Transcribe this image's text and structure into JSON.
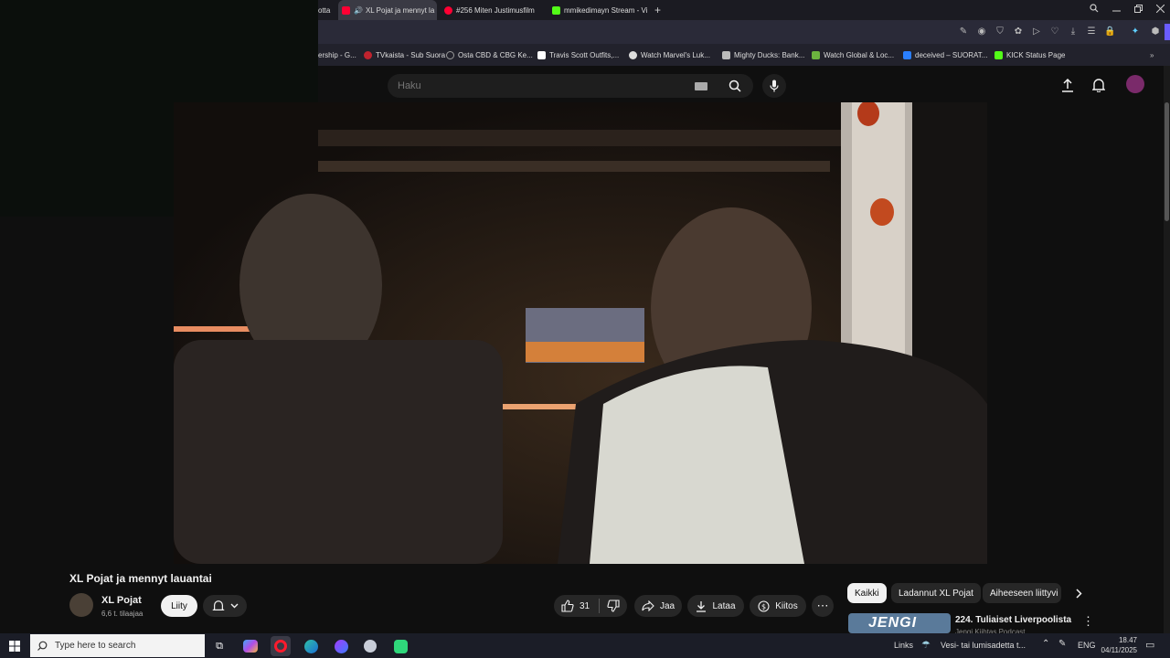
{
  "tabs": [
    {
      "label": "otta",
      "active": false
    },
    {
      "label": "XL Pojat ja mennyt la",
      "active": true
    },
    {
      "label": "#256 Miten Justimusfilm",
      "active": false
    },
    {
      "label": "mmikedimayn Stream - Vi",
      "active": false
    }
  ],
  "new_tab_label": "+",
  "bookmarks": [
    {
      "label": "ership - G...",
      "icon": "none"
    },
    {
      "label": "TVkaista - Sub Suora",
      "icon": "tvkaista-icon"
    },
    {
      "label": "Osta CBD & CBG Ke...",
      "icon": "cbd-icon"
    },
    {
      "label": "Travis Scott Outfits,...",
      "icon": "travis-icon"
    },
    {
      "label": "Watch Marvel's Luk...",
      "icon": "marvel-icon"
    },
    {
      "label": "Mighty Ducks: Bank...",
      "icon": "ducks-icon"
    },
    {
      "label": "Watch Global & Loc...",
      "icon": "global-icon"
    },
    {
      "label": "deceived – SUORAT...",
      "icon": "deceived-icon"
    },
    {
      "label": "KICK Status Page",
      "icon": "kick-icon"
    }
  ],
  "search": {
    "placeholder": "Haku"
  },
  "video": {
    "title": "XL Pojat ja mennyt lauantai"
  },
  "channel": {
    "name": "XL Pojat",
    "subscribers": "6,6 t. tilaajaa",
    "join_label": "Liity"
  },
  "actions": {
    "likes": "31",
    "share_label": "Jaa",
    "download_label": "Lataa",
    "thanks_label": "Kiitos"
  },
  "chips": [
    {
      "label": "Kaikki",
      "active": true
    },
    {
      "label": "Ladannut XL Pojat",
      "active": false
    },
    {
      "label": "Aiheeseen liittyvi",
      "active": false
    }
  ],
  "recommendation": {
    "title": "224. Tuliaiset Liverpoolista",
    "channel": "Jengi Kiihtas Podcast",
    "thumb_text": "JENGI"
  },
  "taskbar": {
    "search_placeholder": "Type here to search",
    "links_label": "Links",
    "weather": "Vesi- tai lumisadetta t...",
    "language": "ENG",
    "time": "18.47",
    "date": "04/11/2025"
  },
  "colors": {
    "youtube_red": "#ff0033",
    "kick_green": "#53fc18",
    "chip_active_bg": "#f1f1f1",
    "taskbar_bg": "#1b1d27"
  }
}
